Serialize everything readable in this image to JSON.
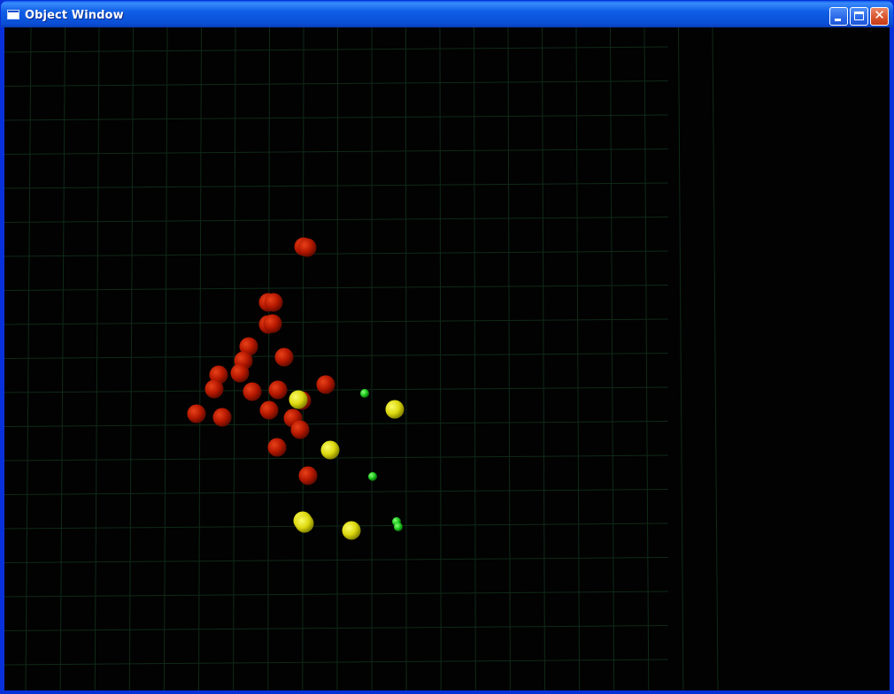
{
  "window": {
    "title": "Object Window",
    "accent_color": "#0831d9",
    "controls": [
      {
        "name": "minimize",
        "icon": "minimize-icon"
      },
      {
        "name": "maximize",
        "icon": "maximize-icon"
      },
      {
        "name": "close",
        "icon": "close-icon",
        "glyph": "✕"
      }
    ]
  },
  "scene": {
    "background_color": "#020202",
    "grid_color": "#0f2a18",
    "objects": {
      "red": {
        "color": "#c41a00",
        "count": 27
      },
      "yellow": {
        "color": "#e6e312",
        "count": 7
      },
      "green": {
        "color": "#1fd01f",
        "count": 5
      }
    }
  }
}
